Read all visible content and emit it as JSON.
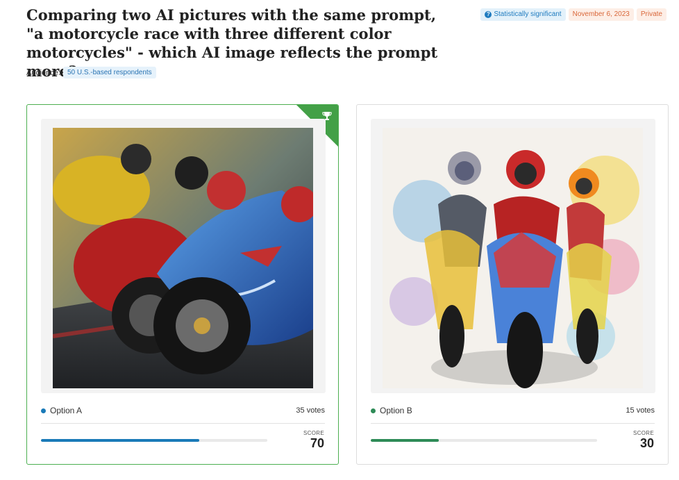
{
  "question": {
    "title": "Comparing two AI pictures with the same prompt, \"a motorcycle race with three different color motorcycles\" - which AI image reflects the prompt more?"
  },
  "audience": {
    "label": "Audience:",
    "value": "50 U.S.-based respondents"
  },
  "badges": {
    "significance": "Statistically significant",
    "date": "November 6, 2023",
    "visibility": "Private"
  },
  "options": [
    {
      "label": "Option A",
      "votes": "35 votes",
      "score_label": "SCORE",
      "score": "70",
      "score_fraction": 0.7,
      "color": "#1a7ab8",
      "winner": true,
      "image": "photorealistic-motorcycle-race"
    },
    {
      "label": "Option B",
      "votes": "15 votes",
      "score_label": "SCORE",
      "score": "30",
      "score_fraction": 0.3,
      "color": "#2e8b57",
      "winner": false,
      "image": "watercolor-motorcycle-race"
    }
  ],
  "icons": {
    "info": "info-icon",
    "trophy": "trophy-icon"
  }
}
